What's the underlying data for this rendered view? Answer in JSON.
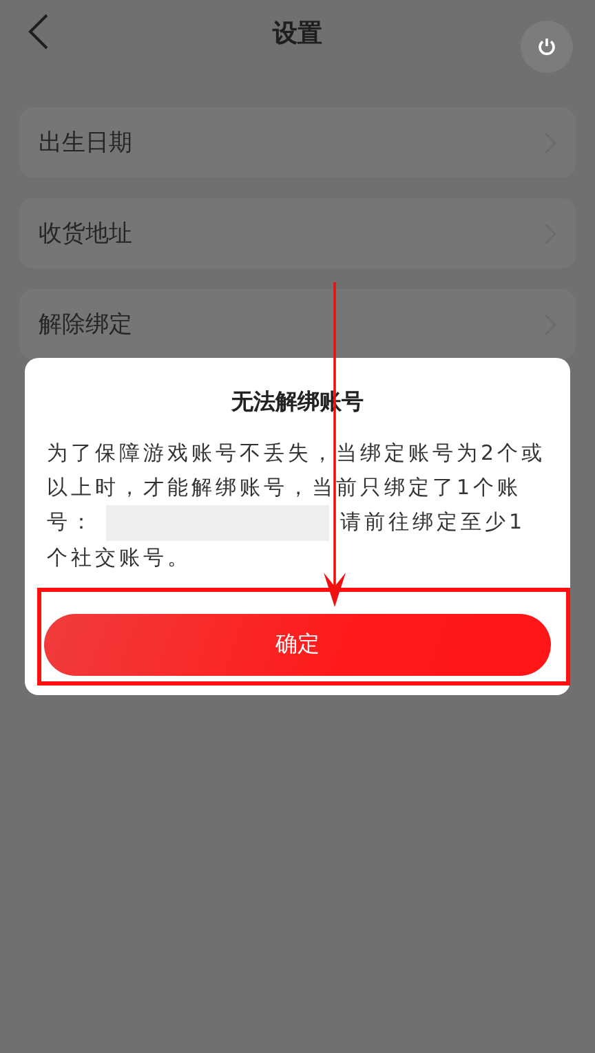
{
  "header": {
    "title": "设置"
  },
  "settings_items": [
    {
      "label": "出生日期"
    },
    {
      "label": "收货地址"
    },
    {
      "label": "解除绑定"
    }
  ],
  "dialog": {
    "title": "无法解绑账号",
    "message_parts": [
      "为了保障游戏账号不丢失，当绑定账号为2个或以上时，才能解绑账号，当前只绑定了1个账号：",
      "请前往绑定至少1个社交账号。"
    ],
    "button": "确定"
  }
}
